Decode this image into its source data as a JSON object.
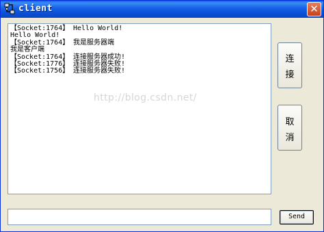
{
  "window": {
    "title": "client",
    "close_glyph": "✕"
  },
  "log": {
    "lines": [
      {
        "prefix": "【Socket:1764】",
        "text": "Hello World!"
      },
      {
        "prefix": "",
        "text": "Hello World!"
      },
      {
        "prefix": "【Socket:1764】",
        "text": "我是服务器端"
      },
      {
        "prefix": "",
        "text": "我是客户端"
      },
      {
        "prefix": "【Socket:1764】",
        "text": "连接服务器成功!"
      },
      {
        "prefix": "【Socket:1776】",
        "text": "连接服务器失败!"
      },
      {
        "prefix": "【Socket:1756】",
        "text": "连接服务器失败!"
      }
    ]
  },
  "watermark": "http://blog.csdn.net/",
  "buttons": {
    "connect": [
      "连",
      "接"
    ],
    "cancel": [
      "取",
      "消"
    ],
    "send": "Send"
  },
  "input": {
    "value": "",
    "placeholder": ""
  },
  "icons": {
    "app": "network-connection-icon",
    "close": "close-icon"
  },
  "colors": {
    "titlebar": "#0b4fd4",
    "close": "#c7401c",
    "window_bg": "#ece9d8"
  }
}
